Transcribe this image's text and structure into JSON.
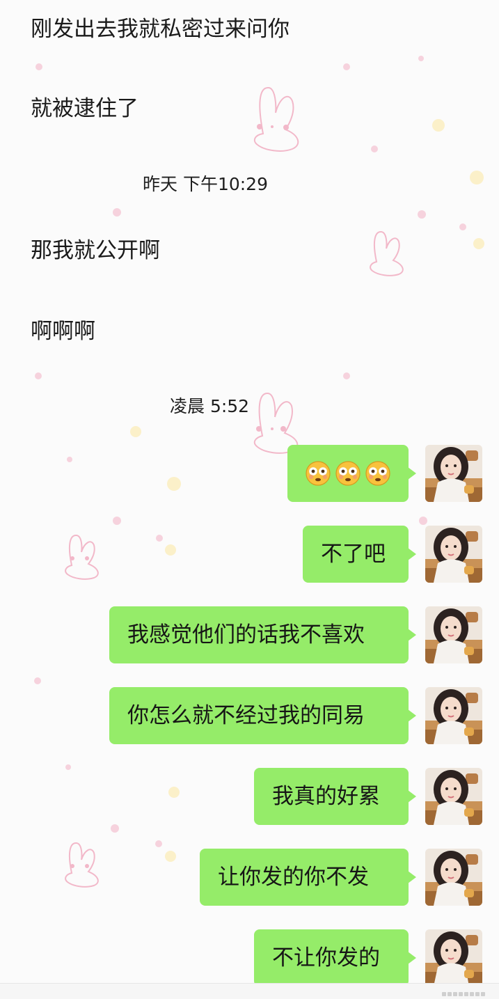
{
  "incoming_text_lines": [
    "刚发出去我就私密过来问你",
    "就被逮住了",
    "那我就公开啊",
    "啊啊啊"
  ],
  "timestamps": [
    "昨天 下午10:29",
    "凌晨 5:52"
  ],
  "sent_messages": [
    "😳😳😳",
    "不了吧",
    "我感觉他们的话我不喜欢",
    "你怎么就不经过我的同易",
    "我真的好累",
    "让你发的你不发",
    "不让你发的"
  ],
  "emoji_message_icon": "flushed-face-emoji-icon",
  "colors": {
    "sent_bubble": "#95ec69",
    "background": "#fbfbfb",
    "decor_pink": "#f2b8c9"
  }
}
